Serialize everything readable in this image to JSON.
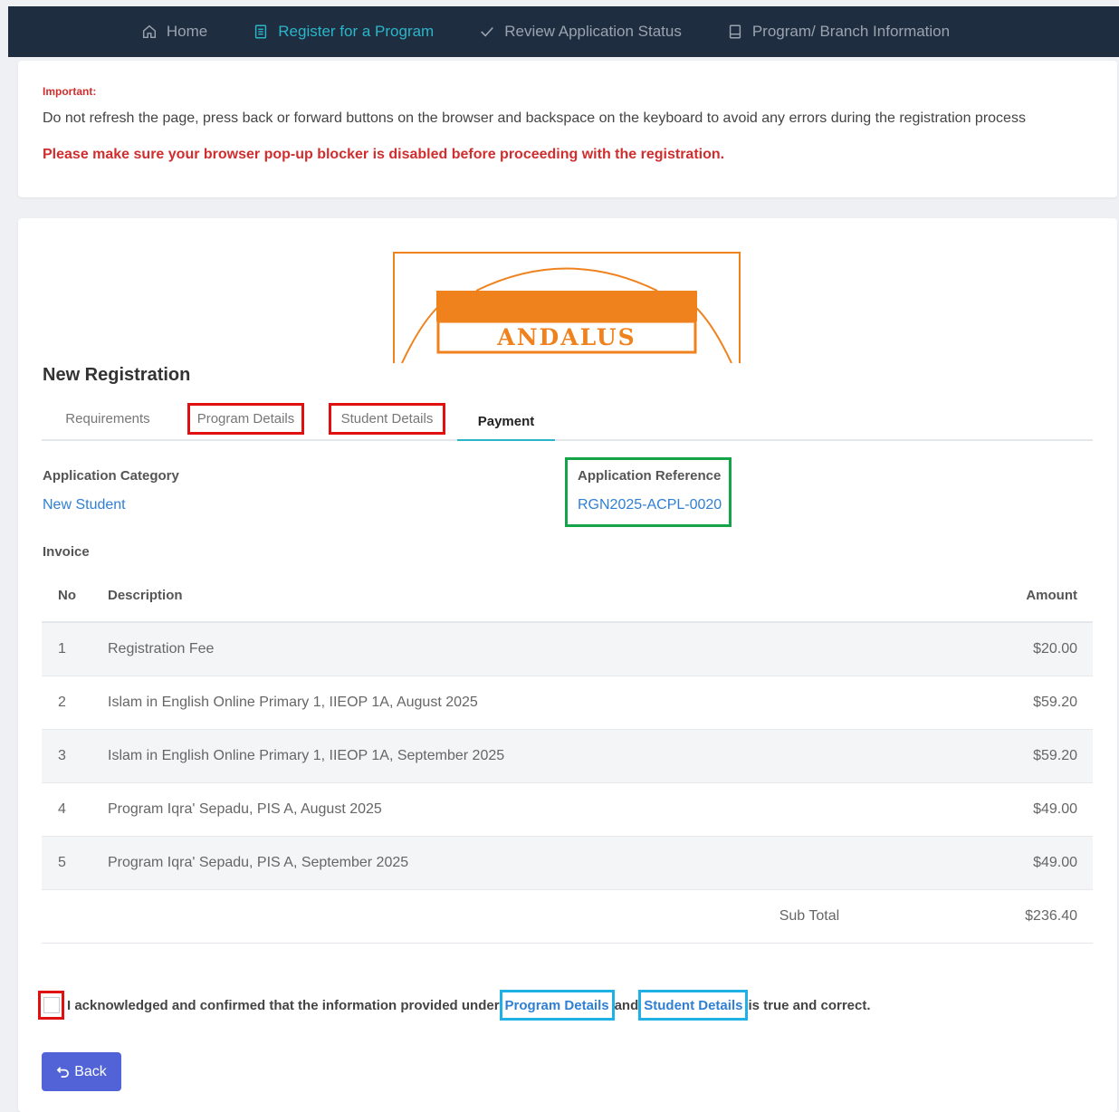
{
  "nav": {
    "items": [
      {
        "label": "Home",
        "icon": "home-icon"
      },
      {
        "label": "Register for a Program",
        "icon": "document-icon",
        "active": true
      },
      {
        "label": "Review Application Status",
        "icon": "check-icon"
      },
      {
        "label": "Program/ Branch Information",
        "icon": "book-icon"
      }
    ]
  },
  "notice": {
    "important_label": "Important:",
    "message": "Do not refresh the page, press back or forward buttons on the browser and backspace on the keyboard to avoid any errors during the registration process",
    "warning": "Please make sure your browser pop-up blocker is disabled before proceeding with the registration."
  },
  "logo": {
    "text": "ANDALUS",
    "color": "#f0821e"
  },
  "page": {
    "title": "New Registration"
  },
  "tabs": [
    {
      "label": "Requirements"
    },
    {
      "label": "Program Details"
    },
    {
      "label": "Student Details"
    },
    {
      "label": "Payment",
      "active": true
    }
  ],
  "application": {
    "category_label": "Application Category",
    "category_value": "New Student",
    "reference_label": "Application Reference",
    "reference_value": "RGN2025-ACPL-0020"
  },
  "invoice": {
    "label": "Invoice",
    "headers": {
      "no": "No",
      "description": "Description",
      "amount": "Amount"
    },
    "rows": [
      {
        "no": "1",
        "description": "Registration Fee",
        "amount": "$20.00"
      },
      {
        "no": "2",
        "description": "Islam in English Online Primary 1, IIEOP 1A, August 2025",
        "amount": "$59.20"
      },
      {
        "no": "3",
        "description": "Islam in English Online Primary 1, IIEOP 1A, September 2025",
        "amount": "$59.20"
      },
      {
        "no": "4",
        "description": "Program Iqra' Sepadu, PIS A, August 2025",
        "amount": "$49.00"
      },
      {
        "no": "5",
        "description": "Program Iqra' Sepadu, PIS A, September 2025",
        "amount": "$49.00"
      }
    ],
    "subtotal_label": "Sub Total",
    "subtotal_value": "$236.40"
  },
  "acknowledge": {
    "prefix": "I acknowledged and confirmed that the information provided under",
    "link1": "Program Details",
    "middle": "and",
    "link2": "Student Details",
    "suffix": "is true and correct."
  },
  "buttons": {
    "back_label": "Back"
  },
  "colors": {
    "navbar": "#1f2d40",
    "accent": "#2bb5c9",
    "link": "#2f7fd4",
    "danger": "#d02e2e",
    "button": "#5163d6"
  }
}
